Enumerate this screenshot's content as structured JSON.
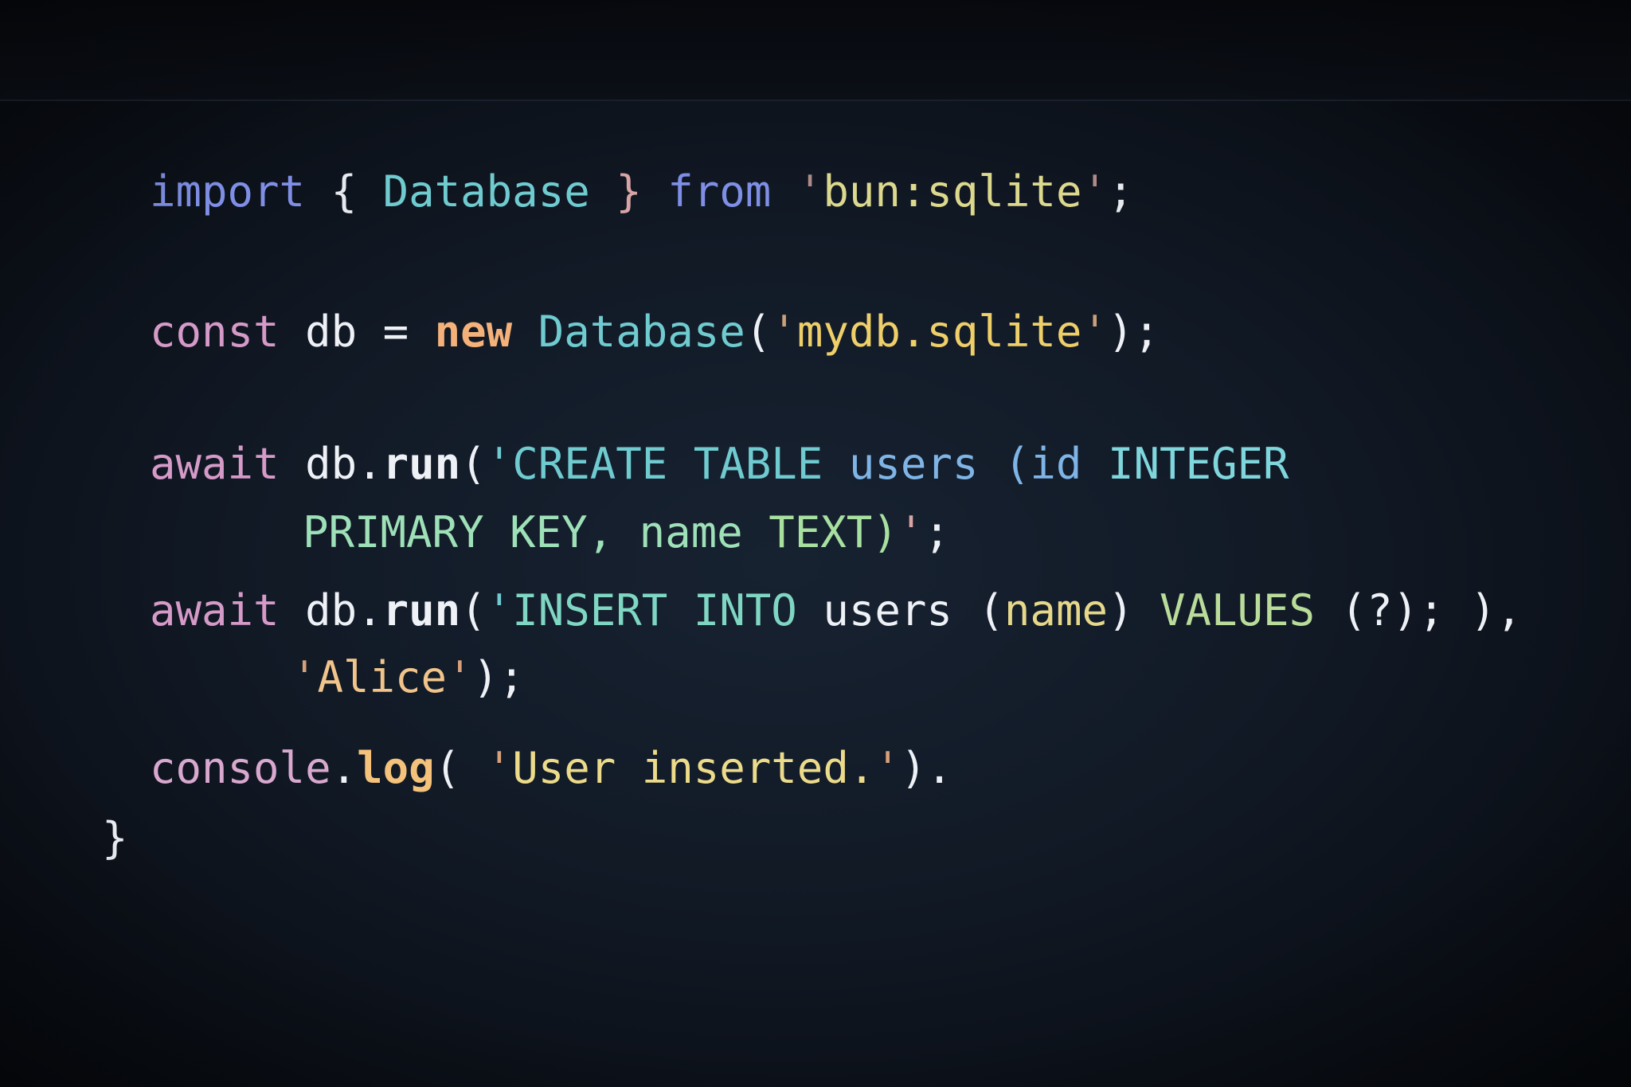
{
  "colors": {
    "background": "#111925",
    "keyword_import": "#7f8fe6",
    "keyword_const": "#d59ac8",
    "keyword_new": "#f4b27a",
    "type_name": "#6fcbd0",
    "identifier": "#eef1f6",
    "string": "#e6d78a",
    "sql": "#7fd6c2",
    "punctuation": "#eef1f6"
  },
  "code": {
    "lines": [
      {
        "tokens": [
          {
            "text": "import",
            "color": "#7f8fe6"
          },
          {
            "text": " { ",
            "color": "#e6e9ee"
          },
          {
            "text": "Database",
            "color": "#6fcbd0"
          },
          {
            "text": " } ",
            "color": "#d7a5a5"
          },
          {
            "text": "from",
            "color": "#7f8fe6"
          },
          {
            "text": " '",
            "color": "#b08a88"
          },
          {
            "text": "bun:sqlite",
            "color": "#dcd88d"
          },
          {
            "text": "'",
            "color": "#b08a88"
          },
          {
            "text": ";",
            "color": "#e6e9ee"
          }
        ]
      },
      {
        "tokens": [
          {
            "text": "const",
            "color": "#d59ac8"
          },
          {
            "text": " db ",
            "color": "#eef1f6"
          },
          {
            "text": "=",
            "color": "#eef1f6"
          },
          {
            "text": " ",
            "color": "#eef1f6"
          },
          {
            "text": "new",
            "color": "#f4b27a",
            "bold": true
          },
          {
            "text": " ",
            "color": "#eef1f6"
          },
          {
            "text": "Database",
            "color": "#6fcbd0"
          },
          {
            "text": "(",
            "color": "#eef1f6"
          },
          {
            "text": "'",
            "color": "#c9a07a"
          },
          {
            "text": "mydb.sqlite",
            "color": "#efcf6a"
          },
          {
            "text": "'",
            "color": "#c9a07a"
          },
          {
            "text": ");",
            "color": "#eef1f6"
          }
        ]
      },
      {
        "tokens": [
          {
            "text": "await",
            "color": "#d59ac8"
          },
          {
            "text": " db.",
            "color": "#eef1f6"
          },
          {
            "text": "run",
            "color": "#eef1f6",
            "bold": true
          },
          {
            "text": "(",
            "color": "#eef1f6"
          },
          {
            "text": "'",
            "color": "#6fcbd0"
          },
          {
            "text": "CREATE TABLE ",
            "color": "#6fcbd0"
          },
          {
            "text": "users ",
            "color": "#7fb5e6"
          },
          {
            "text": "(id ",
            "color": "#7fb5e6"
          },
          {
            "text": "INTEGER",
            "color": "#7fd6dc"
          }
        ]
      },
      {
        "tokens": [
          {
            "text": "PRIMARY KEY, ",
            "color": "#9ee0b8"
          },
          {
            "text": "name ",
            "color": "#9ee0b8"
          },
          {
            "text": "TEXT)",
            "color": "#a8e0a0"
          },
          {
            "text": "'",
            "color": "#d7a5a5"
          },
          {
            "text": ";",
            "color": "#eef1f6"
          }
        ]
      },
      {
        "tokens": [
          {
            "text": "await",
            "color": "#d59ac8"
          },
          {
            "text": " db.",
            "color": "#eef1f6"
          },
          {
            "text": "run",
            "color": "#eef1f6",
            "bold": true
          },
          {
            "text": "(",
            "color": "#eef1f6"
          },
          {
            "text": "'",
            "color": "#6fcbd0"
          },
          {
            "text": "INSERT INTO ",
            "color": "#7fd6c2"
          },
          {
            "text": "users ",
            "color": "#eef1f6"
          },
          {
            "text": "(",
            "color": "#eef1f6"
          },
          {
            "text": "name",
            "color": "#e6d78a"
          },
          {
            "text": ") ",
            "color": "#eef1f6"
          },
          {
            "text": "VALUES ",
            "color": "#b9dc9a"
          },
          {
            "text": "(?); ),",
            "color": "#eef1f6"
          }
        ]
      },
      {
        "tokens": [
          {
            "text": "'",
            "color": "#d6a07a"
          },
          {
            "text": "Alice",
            "color": "#f0c48a"
          },
          {
            "text": "'",
            "color": "#d6a07a"
          },
          {
            "text": ");",
            "color": "#eef1f6"
          }
        ]
      },
      {
        "tokens": [
          {
            "text": "console",
            "color": "#d9a8cf"
          },
          {
            "text": ".",
            "color": "#eef1f6"
          },
          {
            "text": "log",
            "color": "#f4c27a",
            "bold": true
          },
          {
            "text": "( ",
            "color": "#eef1f6"
          },
          {
            "text": "'",
            "color": "#d6a07a"
          },
          {
            "text": "User inserted.",
            "color": "#ecdb8a"
          },
          {
            "text": "'",
            "color": "#d6a07a"
          },
          {
            "text": ").",
            "color": "#eef1f6"
          }
        ]
      },
      {
        "tokens": [
          {
            "text": "}",
            "color": "#eef1f6"
          }
        ]
      }
    ]
  }
}
